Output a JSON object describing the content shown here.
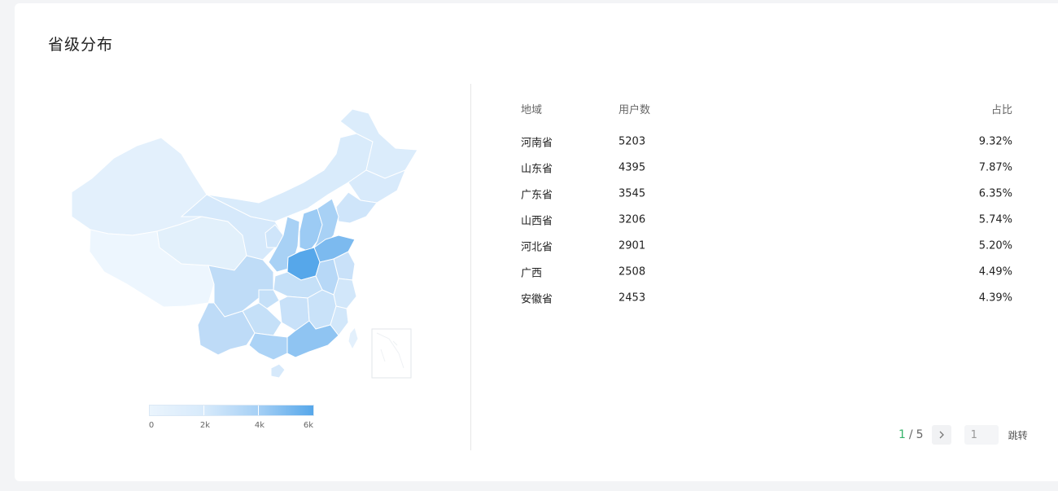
{
  "panel": {
    "title": "省级分布"
  },
  "legend": {
    "ticks": [
      "0",
      "2k",
      "4k",
      "6k"
    ]
  },
  "colors": {
    "accent": "#36b36a",
    "map_low": "#eaf4fd",
    "map_high": "#56a7ea"
  },
  "table": {
    "headers": {
      "region": "地域",
      "users": "用户数",
      "share": "占比"
    },
    "rows": [
      {
        "region": "河南省",
        "users": "5203",
        "share": "9.32%"
      },
      {
        "region": "山东省",
        "users": "4395",
        "share": "7.87%"
      },
      {
        "region": "广东省",
        "users": "3545",
        "share": "6.35%"
      },
      {
        "region": "山西省",
        "users": "3206",
        "share": "5.74%"
      },
      {
        "region": "河北省",
        "users": "2901",
        "share": "5.20%"
      },
      {
        "region": "广西",
        "users": "2508",
        "share": "4.49%"
      },
      {
        "region": "安徽省",
        "users": "2453",
        "share": "4.39%"
      }
    ]
  },
  "pagination": {
    "current": "1",
    "separator": "/",
    "total": "5",
    "next_icon": "chevron-right-icon",
    "jump_value": "1",
    "jump_label": "跳转"
  }
}
